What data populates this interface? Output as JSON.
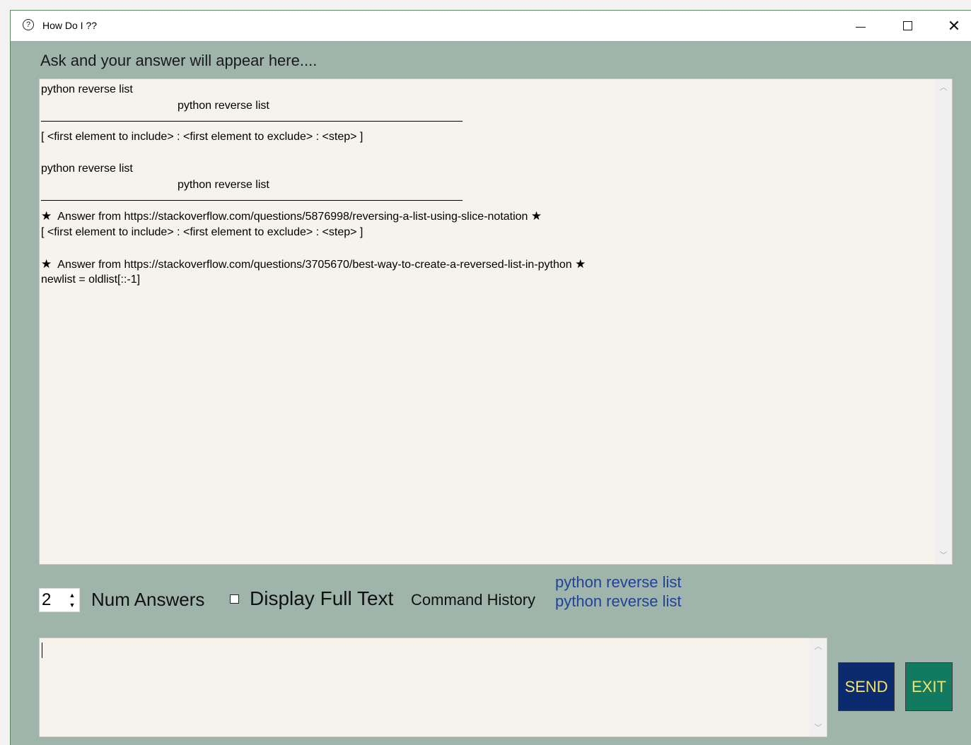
{
  "window": {
    "title": "How Do I ??",
    "app_icon": "question-circle-icon",
    "close_glyph": "✕"
  },
  "prompt_label": "Ask and your answer will appear here....",
  "output": {
    "lines": [
      "python reverse list",
      "python reverse list",
      "[ <first element to include> : <first element to exclude> : <step> ]",
      "python reverse list",
      "python reverse list",
      "Answer from https://stackoverflow.com/questions/5876998/reversing-a-list-using-slice-notation",
      "[ <first element to include> : <first element to exclude> : <step> ]",
      "Answer from https://stackoverflow.com/questions/3705670/best-way-to-create-a-reversed-list-in-python",
      "newlist = oldlist[::-1]"
    ],
    "star_glyph": "★"
  },
  "controls": {
    "num_answers_value": "2",
    "num_answers_label": "Num Answers",
    "display_full_text_label": "Display Full Text",
    "display_full_text_checked": false,
    "command_history_label": "Command History",
    "history_items": [
      "python reverse list",
      "python reverse list"
    ]
  },
  "input": {
    "value": ""
  },
  "buttons": {
    "send": "SEND",
    "exit": "EXIT"
  },
  "colors": {
    "window_bg": "#9fb5ab",
    "text_area_bg": "#f6f2ec",
    "send_bg": "#0c2b6e",
    "exit_bg": "#127a60",
    "button_text": "#f2e36a",
    "history_text": "#21429a"
  }
}
